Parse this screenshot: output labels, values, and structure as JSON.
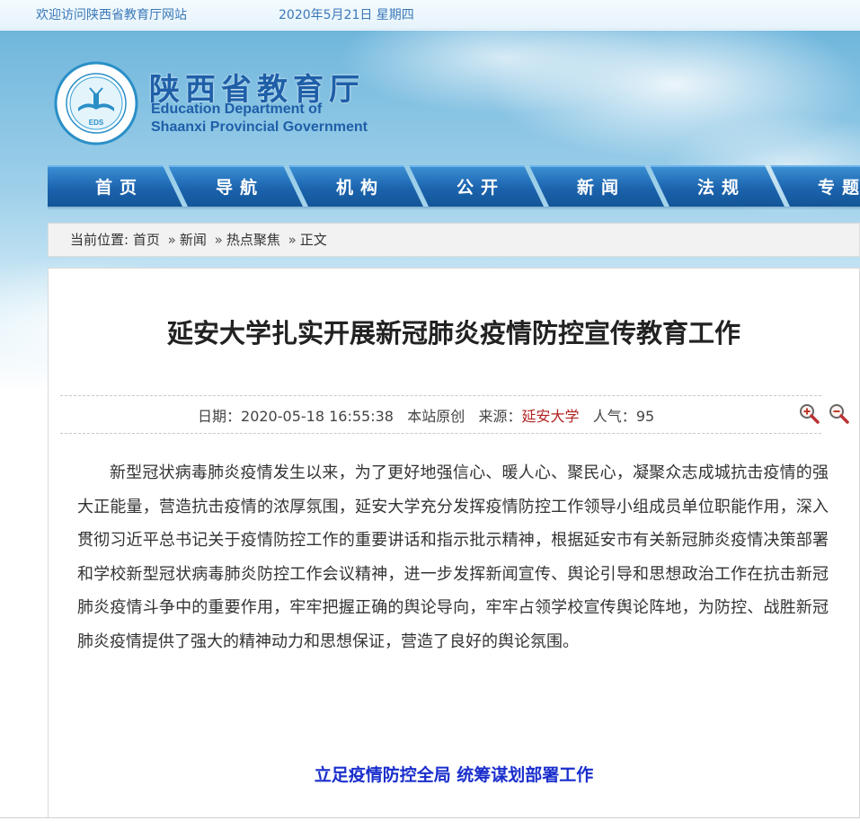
{
  "topbar": {
    "welcome": "欢迎访问陕西省教育厅网站",
    "date": "2020年5月21日 星期四"
  },
  "logo": {
    "name_cn": "陕西省教育厅",
    "name_en_line1": "Education Department of",
    "name_en_line2": "Shaanxi Provincial Government",
    "emblem_text": "EDS"
  },
  "nav": {
    "items": [
      {
        "label": "首页"
      },
      {
        "label": "导航"
      },
      {
        "label": "机构"
      },
      {
        "label": "公开"
      },
      {
        "label": "新闻"
      },
      {
        "label": "法规"
      },
      {
        "label": "专题"
      }
    ]
  },
  "breadcrumb": {
    "prefix": "当前位置:",
    "items": [
      "首页",
      "新闻",
      "热点聚焦",
      "正文"
    ],
    "separator": "»"
  },
  "article": {
    "title": "延安大学扎实开展新冠肺炎疫情防控宣传教育工作",
    "date_label": "日期：",
    "date_value": "2020-05-18 16:55:38",
    "origin": "本站原创",
    "source_label": "来源：",
    "source_value": "延安大学",
    "views_label": "人气：",
    "views_value": "95",
    "body": "新型冠状病毒肺炎疫情发生以来，为了更好地强信心、暖人心、聚民心，凝聚众志成城抗击疫情的强大正能量，营造抗击疫情的浓厚氛围，延安大学充分发挥疫情防控工作领导小组成员单位职能作用，深入贯彻习近平总书记关于疫情防控工作的重要讲话和指示批示精神，根据延安市有关新冠肺炎疫情决策部署和学校新型冠状病毒肺炎防控工作会议精神，进一步发挥新闻宣传、舆论引导和思想政治工作在抗击新冠肺炎疫情斗争中的重要作用，牢牢把握正确的舆论导向，牢牢占领学校宣传舆论阵地，为防控、战胜新冠肺炎疫情提供了强大的精神动力和思想保证，营造了良好的舆论氛围。",
    "subheading": "立足疫情防控全局 统筹谋划部署工作"
  },
  "colors": {
    "nav_blue": "#1b63ad",
    "logo_blue": "#1f5fa8",
    "source_red": "#b22222",
    "subheading_blue": "#1a2ecc"
  },
  "icons": {
    "zoom_in": "zoom-in-icon",
    "zoom_out": "zoom-out-icon"
  }
}
